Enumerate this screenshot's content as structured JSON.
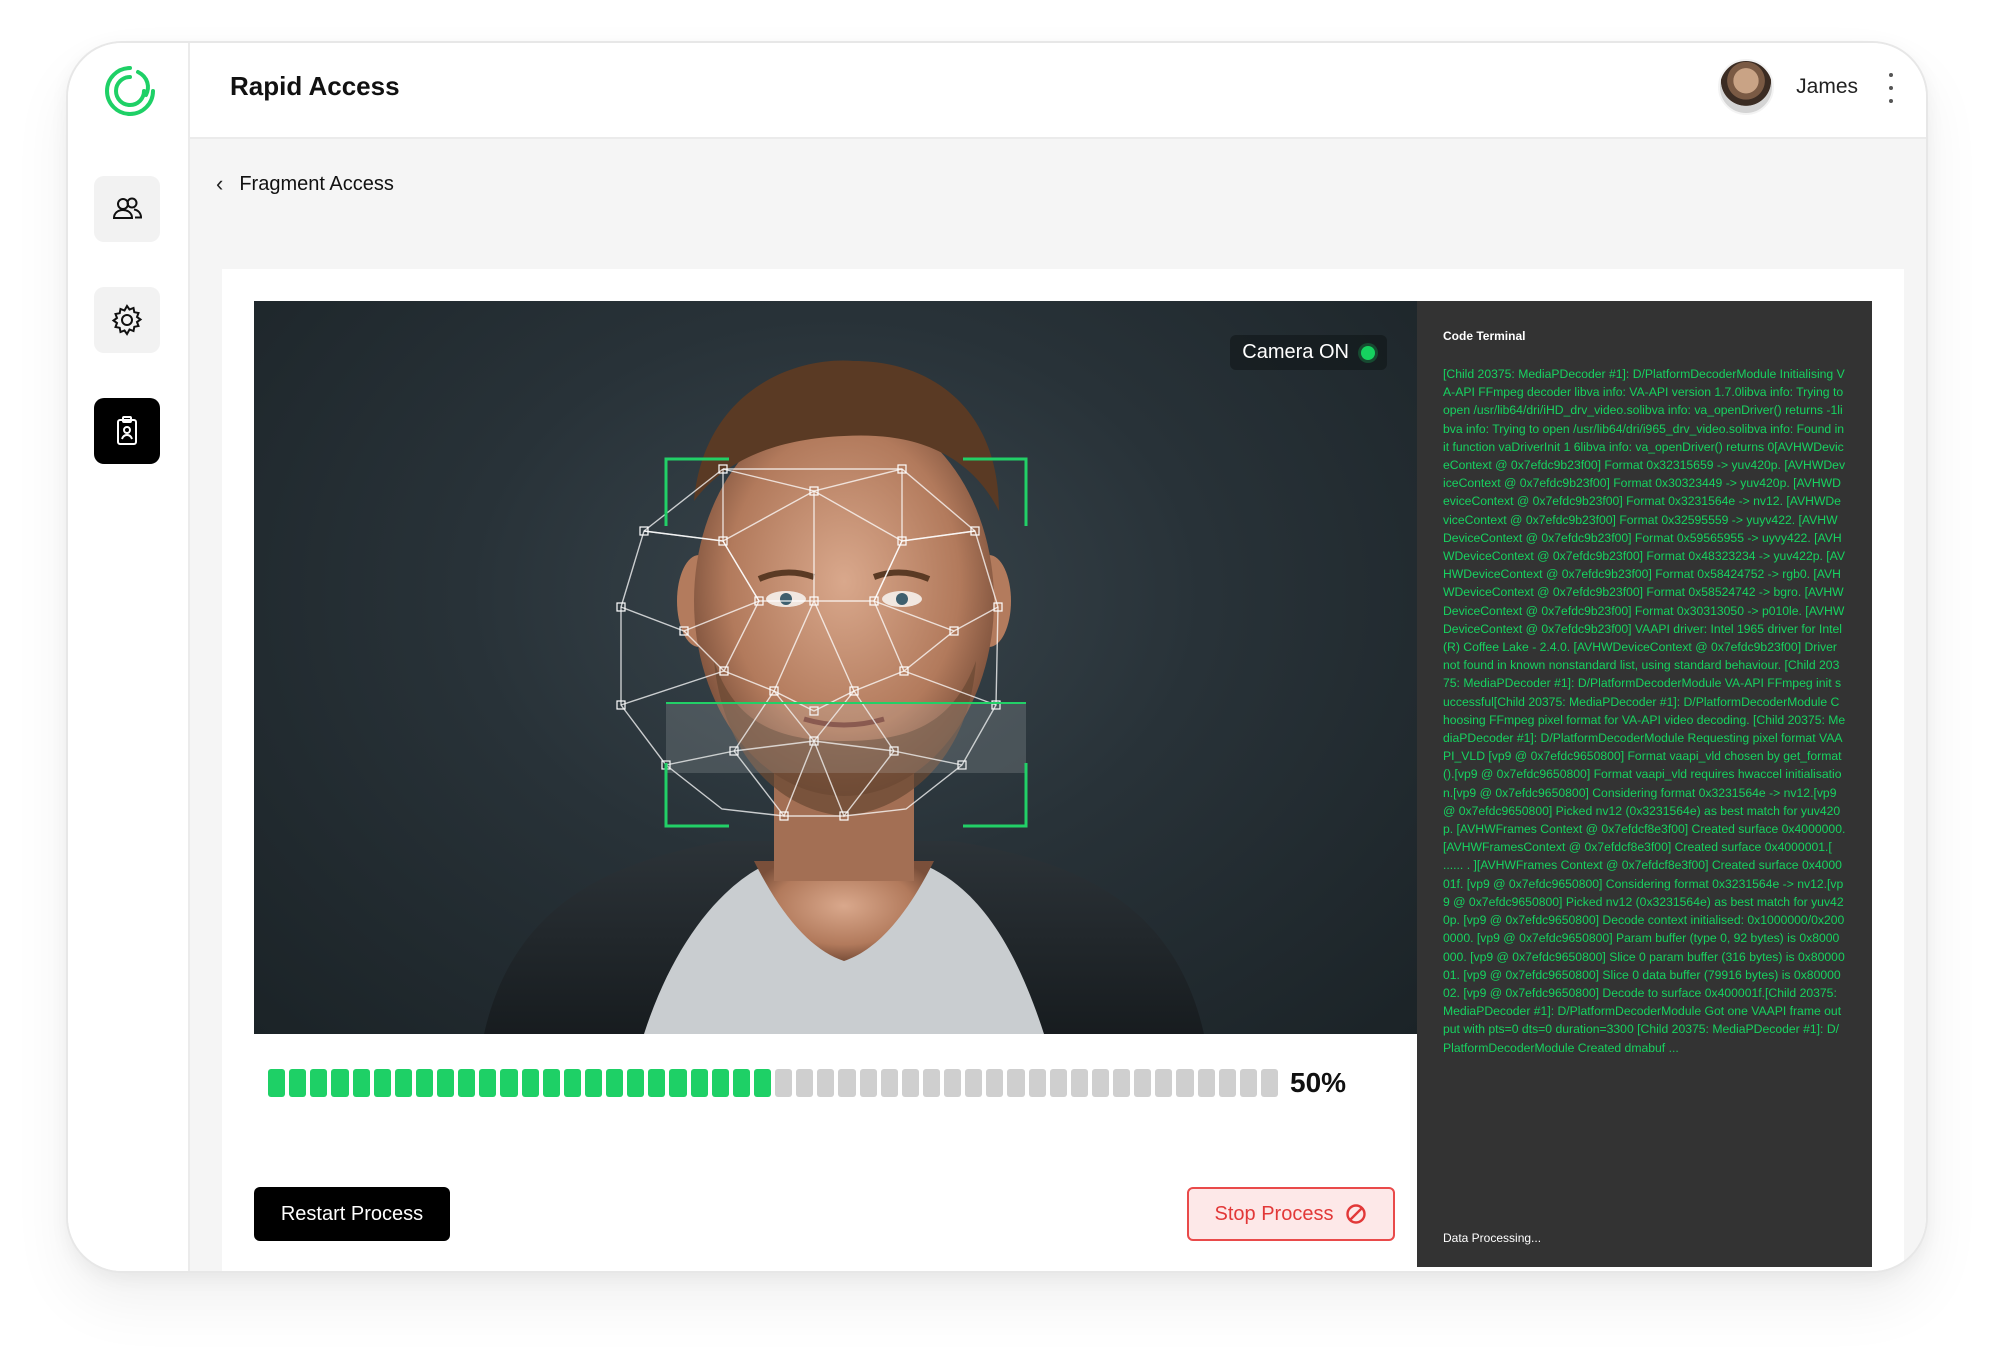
{
  "app": {
    "title": "Rapid Access"
  },
  "user": {
    "name": "James"
  },
  "breadcrumb": {
    "label": "Fragment Access"
  },
  "camera": {
    "status_label": "Camera ON"
  },
  "progress": {
    "value": 0.5,
    "label": "50%"
  },
  "actions": {
    "restart_label": "Restart Process",
    "stop_label": "Stop Process"
  },
  "terminal": {
    "title": "Code Terminal",
    "log": "[Child 20375: MediaPDecoder #1]: D/PlatformDecoderModule Initialising VA-API FFmpeg decoder libva info: VA-API version 1.7.0libva info: Trying to open /usr/lib64/dri/iHD_drv_video.solibva info: va_openDriver() returns -1libva info: Trying to open /usr/lib64/dri/i965_drv_video.solibva info: Found init function vaDriverInit 1 6libva info: va_openDriver() returns 0[AVHWDeviceContext @ 0x7efdc9b23f00] Format 0x32315659 -> yuv420p. [AVHWDeviceContext @ 0x7efdc9b23f00] Format 0x30323449 -> yuv420p. [AVHWDeviceContext @ 0x7efdc9b23f00] Format 0x3231564e -> nv12. [AVHWDeviceContext @ 0x7efdc9b23f00] Format 0x32595559 -> yuyv422. [AVHWDeviceContext @ 0x7efdc9b23f00] Format 0x59565955 -> uyvy422. [AVHWDeviceContext @ 0x7efdc9b23f00] Format 0x48323234 -> yuv422p. [AVHWDeviceContext @ 0x7efdc9b23f00] Format 0x58424752 -> rgb0. [AVHWDeviceContext @ 0x7efdc9b23f00] Format 0x58524742 -> bgro. [AVHWDeviceContext @ 0x7efdc9b23f00] Format 0x30313050 -> p010le. [AVHWDeviceContext @ 0x7efdc9b23f00] VAAPI driver: Intel 1965 driver for Intel(R) Coffee Lake - 2.4.0. [AVHWDeviceContext @ 0x7efdc9b23f00] Driver not found in known nonstandard list, using standard behaviour. [Child 20375: MediaPDecoder #1]: D/PlatformDecoderModule VA-API FFmpeg init successful[Child 20375: MediaPDecoder #1]: D/PlatformDecoderModule Choosing FFmpeg pixel format for VA-API video decoding. [Child 20375: MediaPDecoder #1]: D/PlatformDecoderModule Requesting pixel format VAAPI_VLD [vp9 @ 0x7efdc9650800] Format vaapi_vld chosen by get_format().[vp9 @ 0x7efdc9650800] Format vaapi_vld requires hwaccel initialisation.[vp9 @ 0x7efdc9650800] Considering format 0x3231564e -> nv12.[vp9 @ 0x7efdc9650800] Picked nv12 (0x3231564e) as best match for yuv420p. [AVHWFrames Context @ 0x7efdcf8e3f00] Created surface 0x4000000. [AVHWFramesContext @ 0x7efdcf8e3f00] Created surface 0x4000001.[ ...... . ][AVHWFrames Context @ 0x7efdcf8e3f00] Created surface 0x400001f. [vp9 @ 0x7efdc9650800] Considering format 0x3231564e -> nv12.[vp9 @ 0x7efdc9650800] Picked nv12 (0x3231564e) as best match for yuv420p. [vp9 @ 0x7efdc9650800] Decode context initialised: 0x1000000/0x2000000. [vp9 @ 0x7efdc9650800] Param buffer (type 0, 92 bytes) is 0x8000000. [vp9 @ 0x7efdc9650800] Slice 0 param buffer (316 bytes) is 0x8000001. [vp9 @ 0x7efdc9650800] Slice 0 data buffer (79916 bytes) is 0x8000002. [vp9 @ 0x7efdc9650800] Decode to surface 0x400001f.[Child 20375: MediaPDecoder #1]: D/PlatformDecoderModule Got one VAAPI frame output with pts=0 dts=0 duration=3300 [Child 20375: MediaPDecoder #1]: D/PlatformDecoderModule Created dmabuf ...",
    "status": "Data Processing..."
  },
  "icons": {
    "logo": "brand-logo-icon",
    "sidebar": [
      "users-icon",
      "gear-icon",
      "id-badge-icon"
    ],
    "back": "chevron-left-icon",
    "menu": "kebab-menu-icon",
    "stop": "prohibit-icon"
  },
  "colors": {
    "accent": "#1ed066",
    "danger": "#e23838",
    "terminal_bg": "#333333",
    "terminal_text": "#17d260"
  }
}
